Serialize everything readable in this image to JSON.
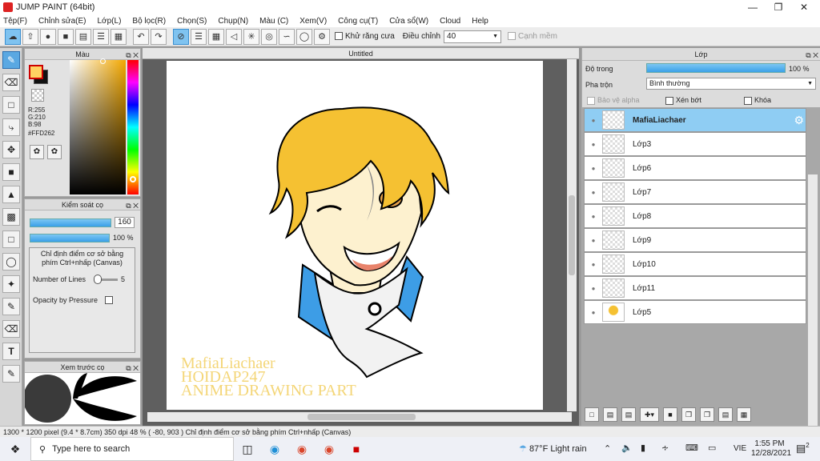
{
  "window": {
    "title": "JUMP PAINT (64bit)"
  },
  "menu": [
    "Tệp(F)",
    "Chỉnh sửa(E)",
    "Lớp(L)",
    "Bộ lọc(R)",
    "Chọn(S)",
    "Chụp(N)",
    "Màu (C)",
    "Xem(V)",
    "Công cụ(T)",
    "Cửa sổ(W)",
    "Cloud",
    "Help"
  ],
  "toolbar": {
    "antialias_label": "Khử răng cưa",
    "adjust_label": "Điều chỉnh",
    "adjust_value": "40",
    "snap_label": "Cạnh mềm"
  },
  "color_panel": {
    "title": "Màu",
    "r": "R:255",
    "g": "G:210",
    "b": "B:98",
    "hex": "#FFD262"
  },
  "brush_panel": {
    "title": "Kiểm soát cọ",
    "size": "160",
    "opacity": "100 %",
    "hint": "Chỉ định điểm cơ sở bằng phím Ctrl+nhấp (Canvas)",
    "lines_label": "Number of Lines",
    "lines_value": "5",
    "pressure_label": "Opacity by Pressure"
  },
  "preview_panel": {
    "title": "Xem trước cọ"
  },
  "document": {
    "tab": "Untitled",
    "watermark": [
      "MafiaLiachaer",
      "HOIDAP247",
      "ANIME DRAWING PART"
    ]
  },
  "layer_panel": {
    "title": "Lớp",
    "opacity_label": "Độ trong",
    "opacity_value": "100 %",
    "blend_label": "Pha trộn",
    "blend_value": "Bình thường",
    "protect_alpha": "Bảo vệ alpha",
    "clip": "Xén bớt",
    "lock": "Khóa",
    "layers": [
      "MafiaLiachaer",
      "Lớp3",
      "Lớp6",
      "Lớp7",
      "Lớp8",
      "Lớp9",
      "Lớp10",
      "Lớp11",
      "Lớp5"
    ]
  },
  "status": "1300 * 1200 pixel  (9.4 * 8.7cm)  350 dpi  48 %  ( -80, 903 )  Chỉ định điểm cơ sở bằng phím Ctrl+nhấp (Canvas)",
  "taskbar": {
    "search_placeholder": "Type here to search",
    "weather": "87°F  Light rain",
    "lang": "VIE",
    "time": "1:55 PM",
    "date": "12/28/2021",
    "notif": "2"
  },
  "colors": {
    "accent": "#8fcdf3",
    "fg": "#FFD262",
    "hair": "#F5C132"
  }
}
